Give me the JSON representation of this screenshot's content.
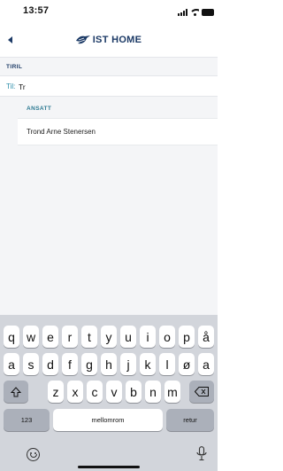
{
  "status_bar": {
    "time": "13:57",
    "icons": [
      "signal-icon",
      "wifi-icon",
      "battery-icon"
    ]
  },
  "nav": {
    "back_icon": "chevron-left-icon",
    "brand_logo_icon": "ist-bird-logo-icon",
    "brand_name": "IST HOME"
  },
  "section": {
    "title": "TIRIL"
  },
  "to_field": {
    "label": "Til:",
    "value": "Tr"
  },
  "suggestions": {
    "group_title": "ANSATT",
    "items": [
      {
        "name": "Trond Arne Stenersen"
      }
    ]
  },
  "keyboard": {
    "row1": [
      "q",
      "w",
      "e",
      "r",
      "t",
      "y",
      "u",
      "i",
      "o",
      "p",
      "å"
    ],
    "row2": [
      "a",
      "s",
      "d",
      "f",
      "g",
      "h",
      "j",
      "k",
      "l",
      "ø",
      "a"
    ],
    "row3": [
      "z",
      "x",
      "c",
      "v",
      "b",
      "n",
      "m"
    ],
    "numbers_label": "123",
    "space_label": "mellomrom",
    "return_label": "retur",
    "shift_icon": "shift-icon",
    "backspace_icon": "backspace-icon",
    "emoji_icon": "emoji-icon",
    "dictation_icon": "microphone-icon"
  },
  "colors": {
    "brand": "#1c3a66",
    "accent": "#2d8eaa",
    "keyboard_bg": "#d2d5db",
    "special_key": "#abb0ba"
  }
}
